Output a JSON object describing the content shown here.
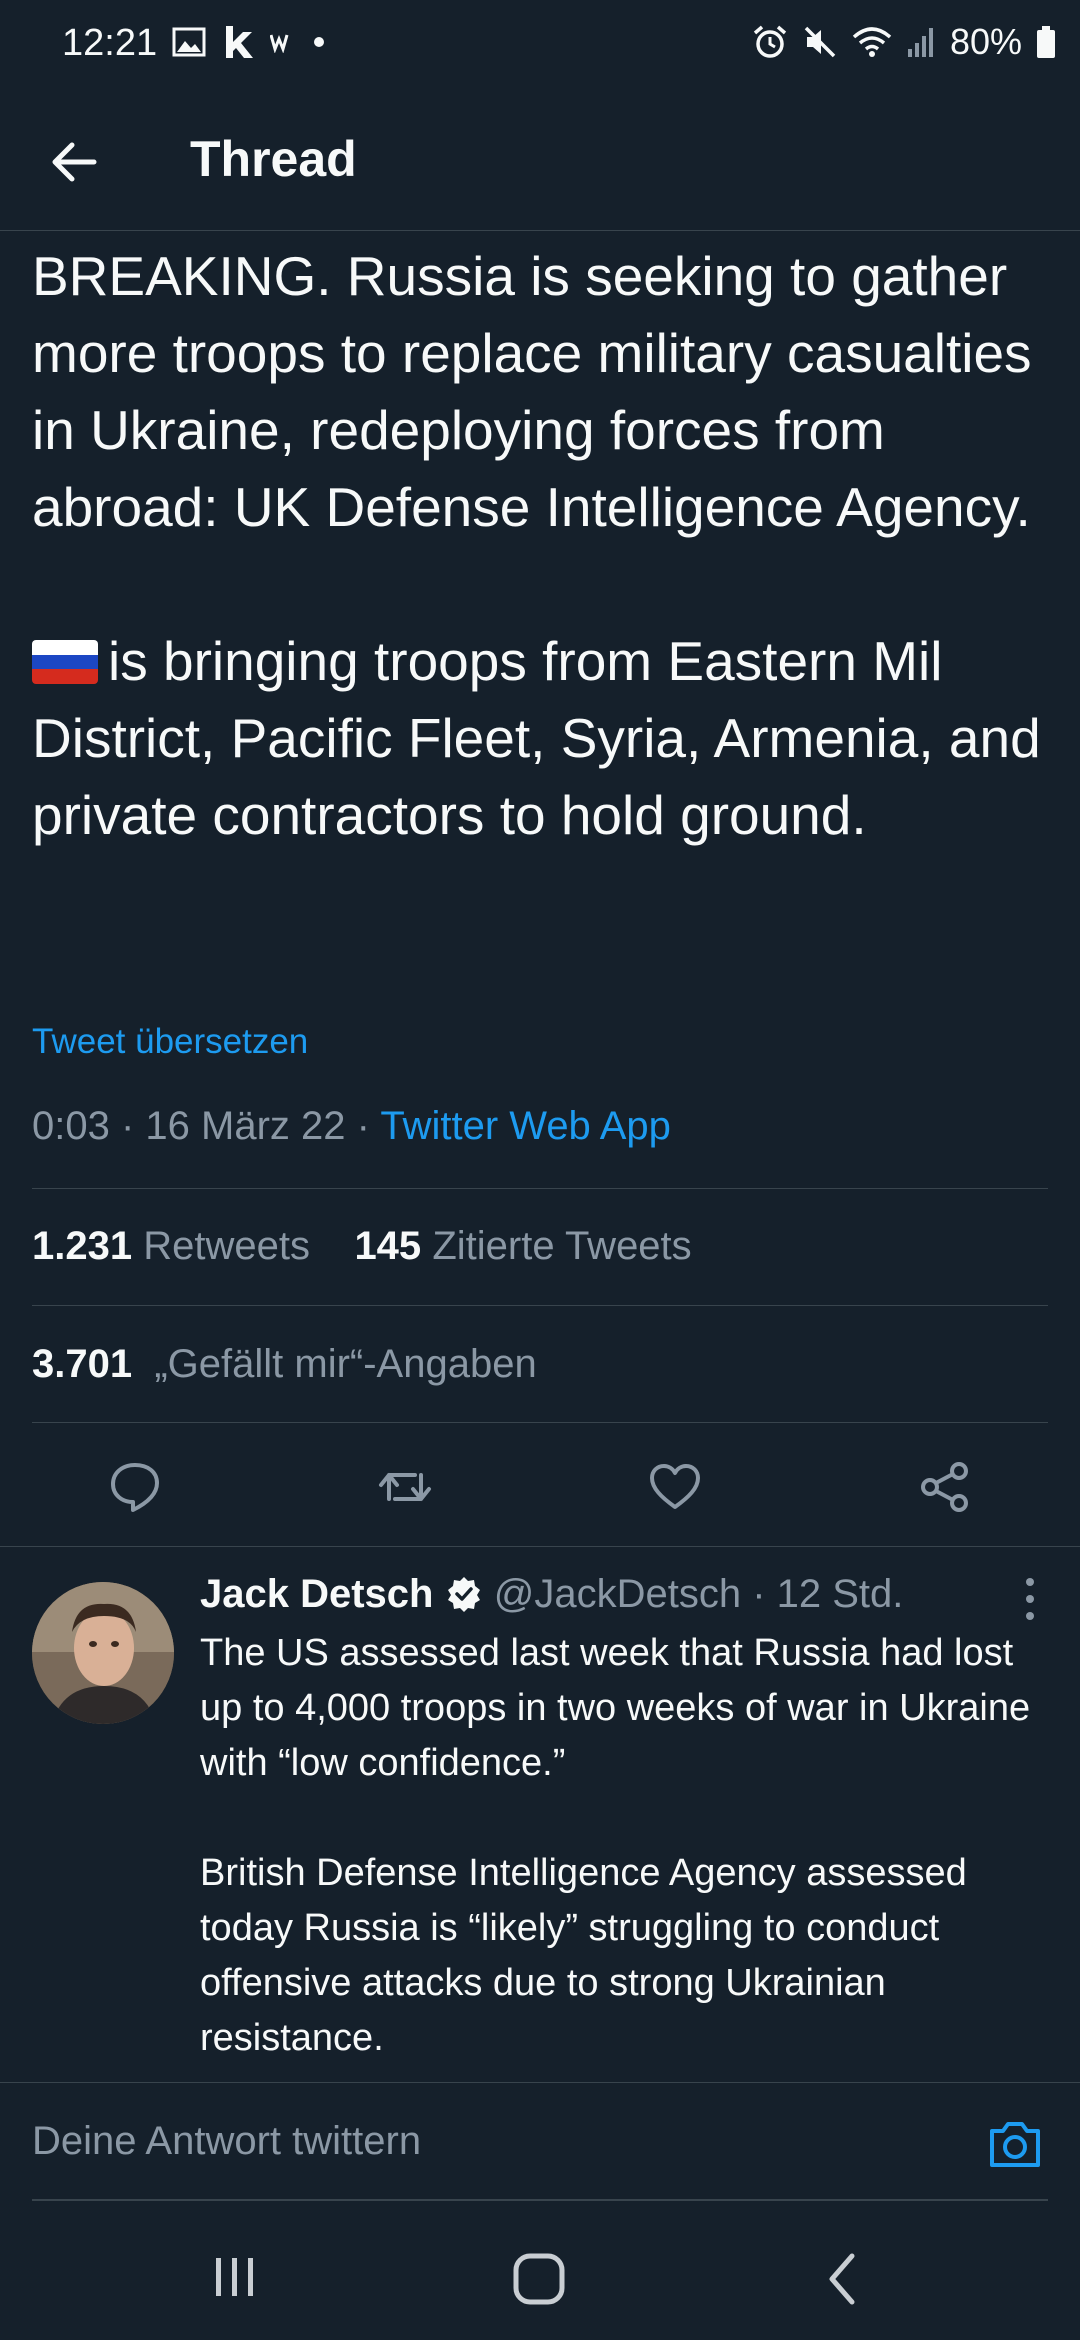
{
  "status_bar": {
    "time": "12:21",
    "battery": "80%"
  },
  "header": {
    "title": "Thread"
  },
  "tweet": {
    "paragraph1": "BREAKING. Russia is seeking to gather more troops to replace military casualties in Ukraine, redeploying forces from abroad: UK Defense Intelligence Agency.",
    "paragraph2": "is bringing troops from Eastern Mil District, Pacific Fleet, Syria, Armenia, and private contractors to hold ground.",
    "translate_label": "Tweet übersetzen",
    "time": "0:03",
    "date": "16 März 22",
    "source": "Twitter Web App",
    "retweets_count": "1.231",
    "retweets_label": "Retweets",
    "quotes_count": "145",
    "quotes_label": "Zitierte Tweets",
    "likes_count": "3.701",
    "likes_label": "„Gefällt mir“-Angaben"
  },
  "reply": {
    "name": "Jack Detsch",
    "handle": "@JackDetsch",
    "time": "12 Std.",
    "text": "The US assessed last week that Russia had lost up to 4,000 troops in two weeks of war in Ukraine with “low confidence.”\n\nBritish Defense Intelligence Agency assessed today Russia is “likely” struggling to conduct offensive attacks due to strong Ukrainian resistance."
  },
  "compose": {
    "placeholder": "Deine Antwort twittern"
  },
  "colors": {
    "background": "#15202b",
    "accent": "#1d9bf0",
    "secondary_text": "#8b98a5",
    "divider": "#38444d"
  }
}
